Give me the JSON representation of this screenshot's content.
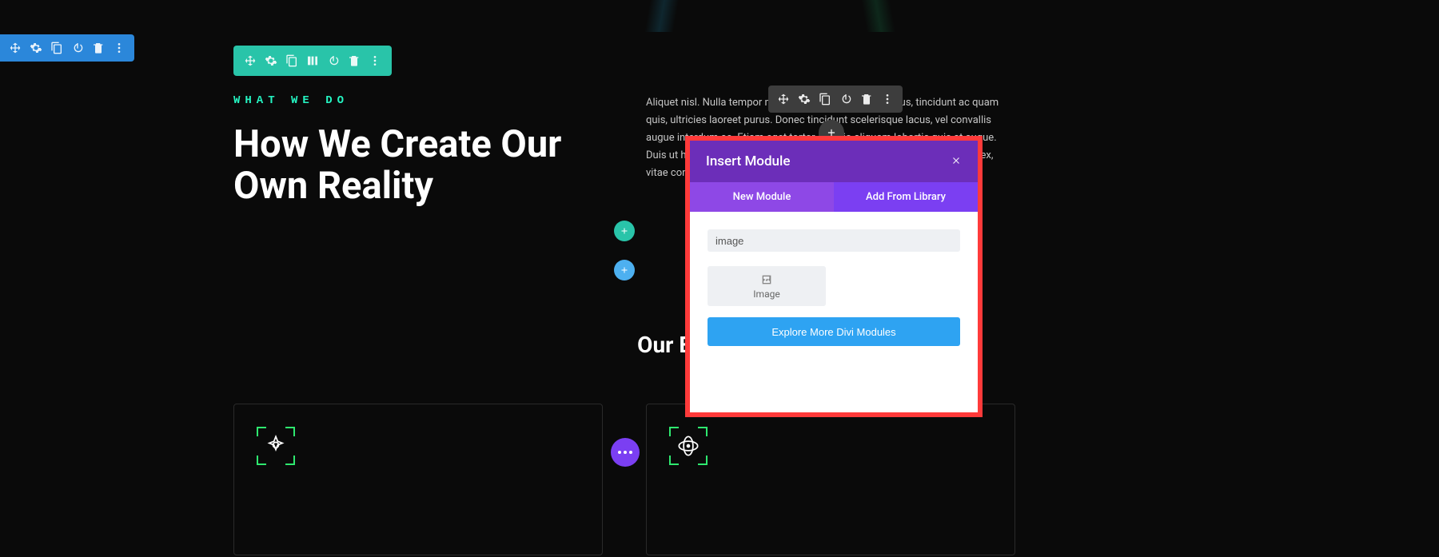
{
  "content": {
    "eyebrow": "WHAT WE DO",
    "headline": "How We Create Our Own Reality",
    "paragraph": "Aliquet nisl. Nulla tempor mauris sed pretium. Ut mi lacus, tincidunt ac quam quis, ultricies laoreet purus. Donec tincidunt scelerisque lacus, vel convallis augue interdum ac. Etiam eget tortor ac odio aliquam lobortis quis at augue. Duis ut hendrerit tellus, elementum lacinia elit. Maecenas at consectetur ex, vitae consequat augue. Vivamus eget dolor vel quam condimentum.",
    "subheading": "Our Experiences"
  },
  "modal": {
    "title": "Insert Module",
    "tabs": {
      "new": "New Module",
      "library": "Add From Library"
    },
    "search_value": "image",
    "module_label": "Image",
    "explore_label": "Explore More Divi Modules"
  }
}
